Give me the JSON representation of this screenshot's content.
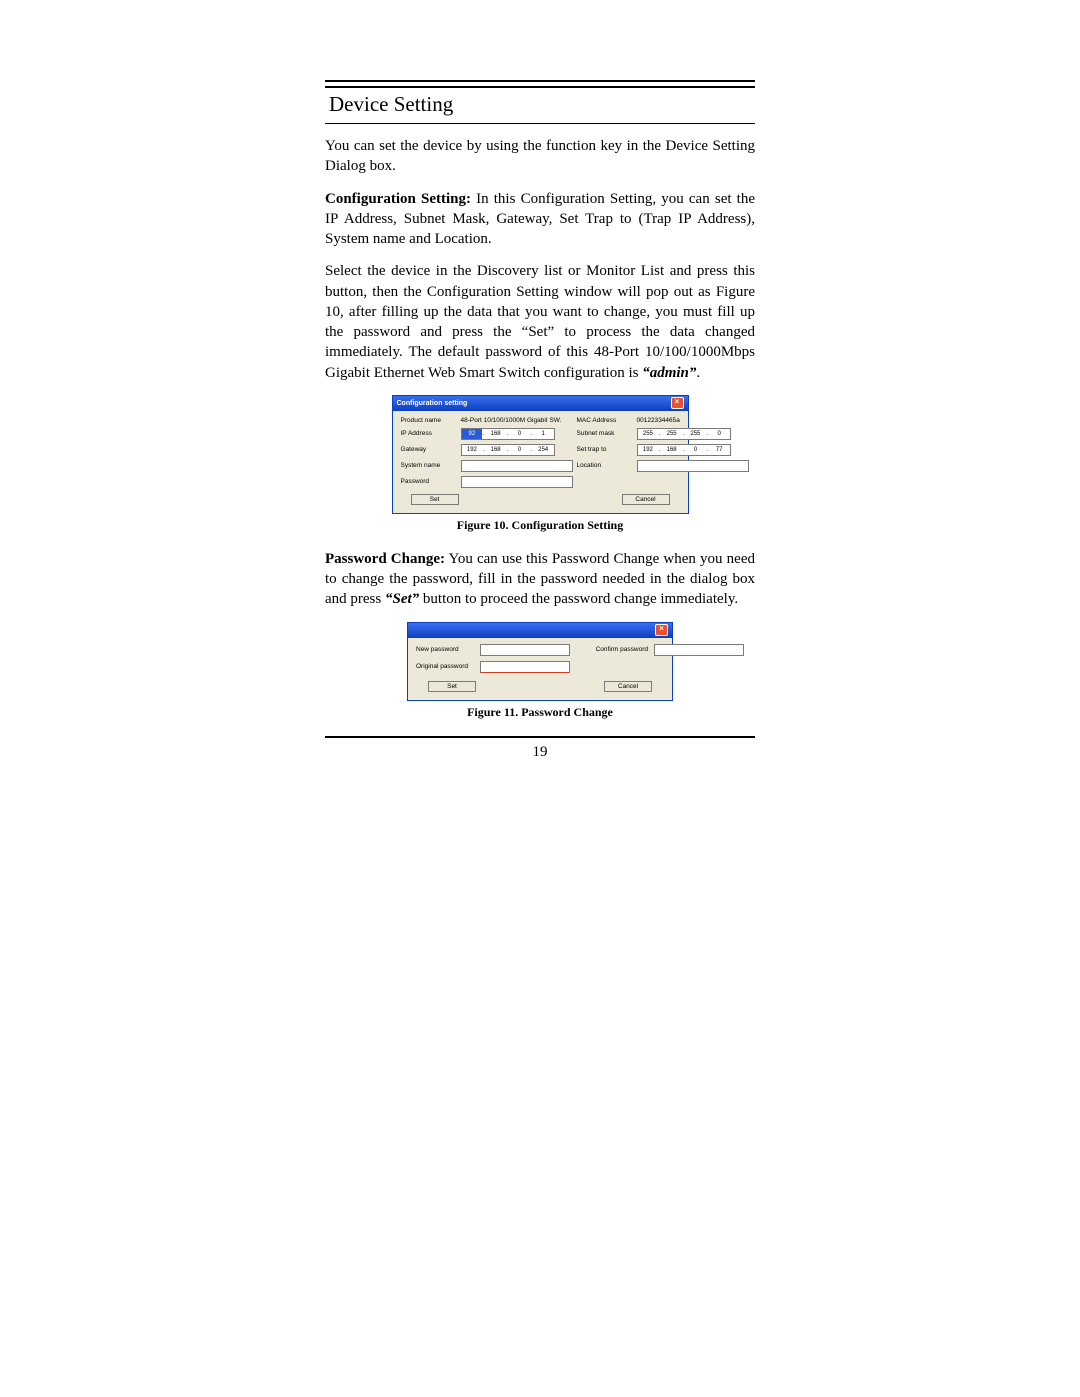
{
  "page": {
    "section_title": "Device Setting",
    "para_intro": "You can set the device by using the function key in the Device Setting Dialog box.",
    "para_config_label": "Configuration Setting:",
    "para_config_body": " In this Configuration Setting, you can set the IP Address, Subnet Mask, Gateway, Set Trap to (Trap IP Address), System name and Location.",
    "para_select_1": "Select the device in the Discovery list or Monitor List and press this button, then the Configuration Setting window will pop out as Figure 10, after filling up the data that you want to change, you must fill up the password and press the “Set” to process the data changed immediately. The default password of this 48-Port 10/100/1000Mbps Gigabit Ethernet Web Smart Switch configuration is ",
    "para_select_admin": "“admin”",
    "para_select_end": ".",
    "caption_fig10": "Figure 10. Configuration Setting",
    "para_pw_label": "Password Change:",
    "para_pw_body_1": " You can use this Password Change when you need to change the password, fill in the password needed in the dialog box and press ",
    "para_pw_set": "“Set”",
    "para_pw_body_2": " button to proceed the password change immediately.",
    "caption_fig11": "Figure 11. Password Change",
    "page_number": "19"
  },
  "config_dialog": {
    "title": "Configuration setting",
    "labels": {
      "product_name": "Product name",
      "mac_address": "MAC Address",
      "ip_address": "IP Address",
      "subnet_mask": "Subnet mask",
      "gateway": "Gateway",
      "set_trap_to": "Set trap to",
      "system_name": "System name",
      "location": "Location",
      "password": "Password"
    },
    "values": {
      "product_name": "48-Port 10/100/1000M Gigabit SW.",
      "mac_address": "00122334465a",
      "ip": [
        "92",
        "168",
        "0",
        "1"
      ],
      "subnet": [
        "255",
        "255",
        "255",
        "0"
      ],
      "gateway": [
        "192",
        "168",
        "0",
        "254"
      ],
      "trap": [
        "192",
        "168",
        "0",
        "77"
      ],
      "system_name": "",
      "location": "",
      "password": ""
    },
    "buttons": {
      "set": "Set",
      "cancel": "Cancel"
    }
  },
  "password_dialog": {
    "title": "",
    "labels": {
      "new_password": "New password",
      "confirm_password": "Confirm password",
      "original_password": "Original password"
    },
    "buttons": {
      "set": "Set",
      "cancel": "Cancel"
    }
  }
}
